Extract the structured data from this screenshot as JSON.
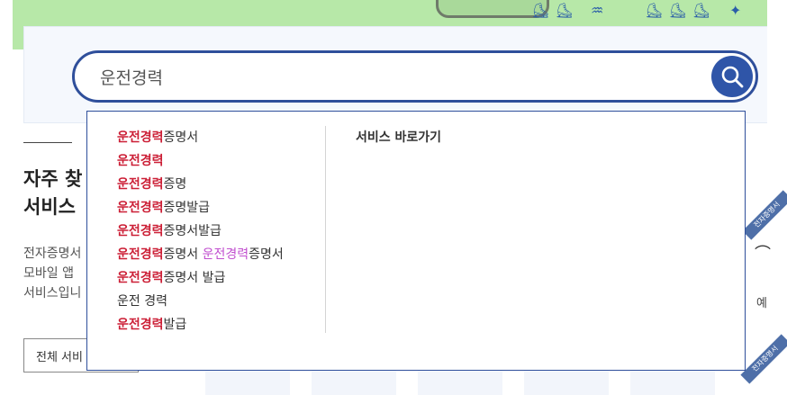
{
  "colors": {
    "accent": "#2f4f9b",
    "highlight": "#cc1f36",
    "highlight_alt": "#c14fcf",
    "banner": "#b7e8a8"
  },
  "search": {
    "value": "운전경력",
    "button_icon": "search-icon"
  },
  "section": {
    "title": "자주 찾\n서비스",
    "description": "전자증명서\n모바일 앱\n서비스입니",
    "all_button": "전체 서비"
  },
  "right_side": {
    "text": "예",
    "ribbon": "전자증명서"
  },
  "cards": {
    "ribbon_label": "전자증명서"
  },
  "dropdown": {
    "service_title": "서비스 바로가기",
    "suggestions": [
      {
        "parts": [
          {
            "text": "운전경력",
            "hl": "red"
          },
          {
            "text": "증명서",
            "hl": ""
          }
        ]
      },
      {
        "parts": [
          {
            "text": "운전경력",
            "hl": "red"
          }
        ]
      },
      {
        "parts": [
          {
            "text": "운전경력",
            "hl": "red"
          },
          {
            "text": "증명",
            "hl": ""
          }
        ]
      },
      {
        "parts": [
          {
            "text": "운전경력",
            "hl": "red"
          },
          {
            "text": "증명발급",
            "hl": ""
          }
        ]
      },
      {
        "parts": [
          {
            "text": "운전경력",
            "hl": "red"
          },
          {
            "text": "증명서발급",
            "hl": ""
          }
        ]
      },
      {
        "parts": [
          {
            "text": "운전경력",
            "hl": "red"
          },
          {
            "text": "증명서 ",
            "hl": ""
          },
          {
            "text": "운전경력",
            "hl": "pink"
          },
          {
            "text": "증명서",
            "hl": ""
          }
        ]
      },
      {
        "parts": [
          {
            "text": "운전경력",
            "hl": "red"
          },
          {
            "text": "증명서 발급",
            "hl": ""
          }
        ]
      },
      {
        "parts": [
          {
            "text": "운전 경력",
            "hl": ""
          }
        ]
      },
      {
        "parts": [
          {
            "text": "운전경력",
            "hl": "red"
          },
          {
            "text": "발급",
            "hl": ""
          }
        ]
      }
    ]
  }
}
